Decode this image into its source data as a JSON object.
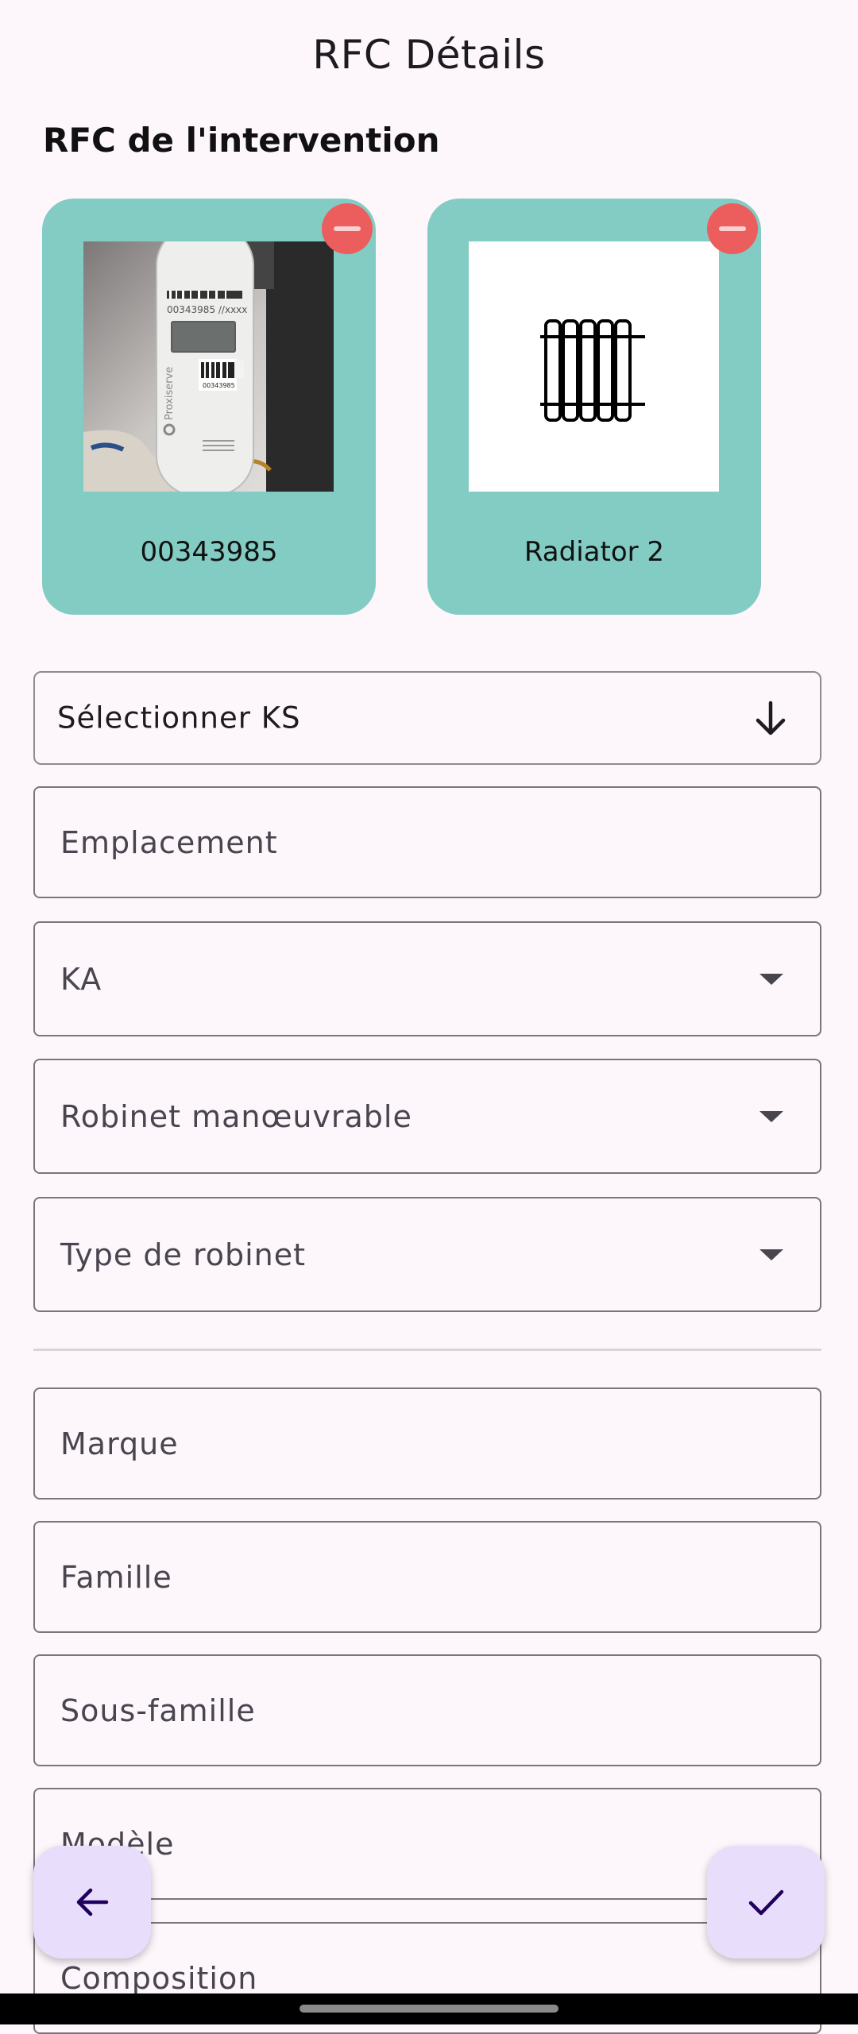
{
  "header": {
    "title": "RFC Détails"
  },
  "section": {
    "title": "RFC de l'intervention"
  },
  "cards": [
    {
      "label": "00343985",
      "image": "meter-photo"
    },
    {
      "label": "Radiator 2",
      "image": "radiator-icon"
    }
  ],
  "meter_photo": {
    "barcode_text": "00343985 //xxxx",
    "small_code": "00343985",
    "brand": "Proxiserve"
  },
  "fields": {
    "select_ks": "Sélectionner KS",
    "emplacement": "Emplacement",
    "ka": "KA",
    "robinet": "Robinet manœuvrable",
    "type_robinet": "Type de robinet",
    "marque": "Marque",
    "famille": "Famille",
    "sous_famille": "Sous-famille",
    "modele": "Modèle",
    "composition": "Composition"
  },
  "colors": {
    "card": "#82ccc3",
    "remove": "#ec5d5d",
    "fab": "#e8ddfb",
    "background": "#fdf7fc"
  }
}
